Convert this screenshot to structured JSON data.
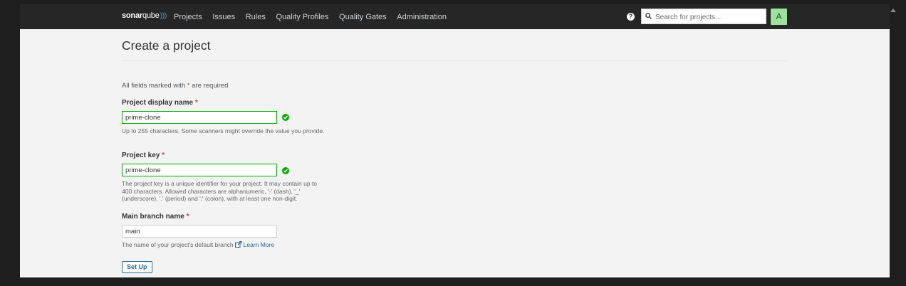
{
  "header": {
    "logo": {
      "strong": "sonar",
      "light": "qube"
    },
    "nav": [
      "Projects",
      "Issues",
      "Rules",
      "Quality Profiles",
      "Quality Gates",
      "Administration"
    ],
    "help_icon": "?",
    "search_placeholder": "Search for projects...",
    "avatar_letter": "A"
  },
  "page": {
    "title": "Create a project",
    "required_note_pre": "All fields marked with ",
    "required_star": "*",
    "required_note_post": " are required"
  },
  "form": {
    "display_name": {
      "label": "Project display name",
      "value": "prime-clone",
      "help": "Up to 255 characters. Some scanners might override the value you provide."
    },
    "project_key": {
      "label": "Project key",
      "value": "prime-clone",
      "help": "The project key is a unique identifier for your project. It may contain up to 400 characters. Allowed characters are alphanumeric, '-' (dash), '_' (underscore), '.' (period) and ':' (colon), with at least one non-digit."
    },
    "main_branch": {
      "label": "Main branch name",
      "value": "main",
      "help": "The name of your project's default branch",
      "link": "Learn More"
    },
    "submit_label": "Set Up"
  },
  "colors": {
    "topbar": "#262626",
    "valid": "#00aa00",
    "accent": "#236a97",
    "required": "#d4333f",
    "avatar": "#9de39d"
  },
  "icons": [
    "sonarqube-logo",
    "help-icon",
    "search-icon",
    "check-icon",
    "external-link-icon"
  ]
}
